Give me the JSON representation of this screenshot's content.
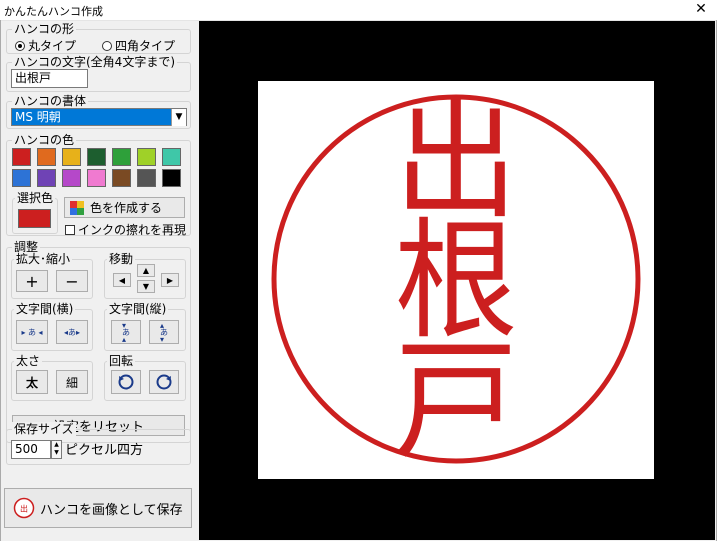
{
  "window": {
    "title": "かんたんハンコ作成",
    "close_glyph": "✕"
  },
  "shape": {
    "label": "ハンコの形",
    "options": [
      "丸タイプ",
      "四角タイプ"
    ],
    "selected": "丸タイプ"
  },
  "text": {
    "label": "ハンコの文字(全角4文字まで)",
    "value": "出根戸"
  },
  "font": {
    "label": "ハンコの書体",
    "value": "MS 明朝"
  },
  "color": {
    "label": "ハンコの色",
    "swatches": [
      "#cc1f1f",
      "#e06a1e",
      "#e7b11a",
      "#1d5e2f",
      "#2ea03a",
      "#9fd128",
      "#3fc7a8",
      "#2d73d6",
      "#6f43b5",
      "#b548c9",
      "#f07ad0",
      "#7a4a23",
      "#555555",
      "#000000"
    ],
    "selected_label": "選択色",
    "selected_color": "#cc1f1f",
    "create_button": "色を作成する",
    "ink_checkbox": "インクの擦れを再現"
  },
  "adjust": {
    "label": "調整",
    "zoom_label": "拡大･縮小",
    "zoom_in": "+",
    "zoom_out": "−",
    "move_label": "移動",
    "char_h_label": "文字間(横)",
    "char_v_label": "文字間(縦)",
    "thick_label": "太さ",
    "thick_btn": "太",
    "thin_btn": "細",
    "rotate_label": "回転",
    "reset_button": "設定をリセット"
  },
  "save": {
    "label": "保存サイズ",
    "size_value": "500",
    "unit": "ピクセル四方",
    "save_button": "ハンコを画像として保存",
    "save_icon_text": "出根"
  },
  "seal": {
    "characters": [
      "出",
      "根",
      "戸"
    ],
    "color": "#cc1f1f"
  }
}
